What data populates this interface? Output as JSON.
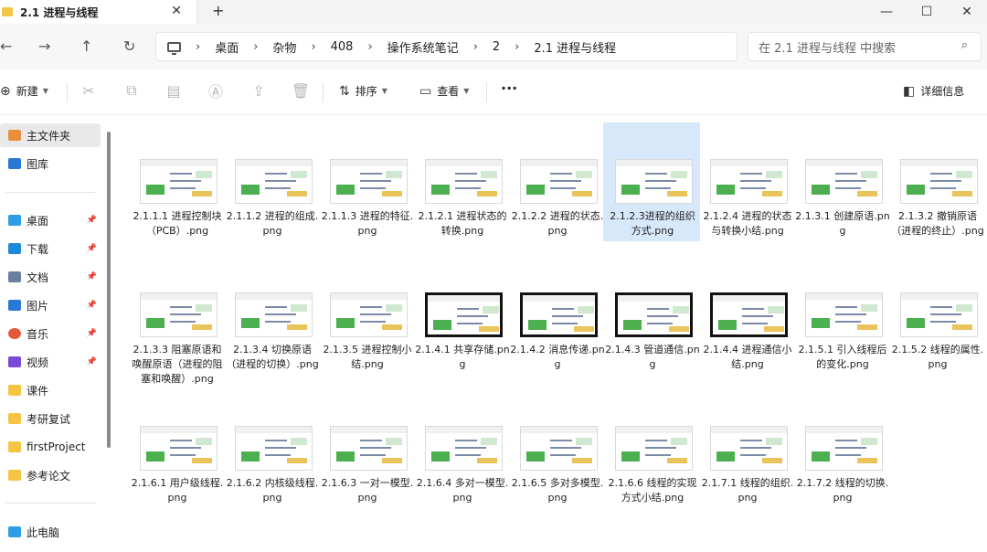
{
  "window": {
    "tab_title": "2.1 进程与线程",
    "tab_close": "✕",
    "new_tab": "+",
    "minimize": "—",
    "maximize": "☐",
    "close": "✕"
  },
  "nav": {
    "back": "←",
    "forward": "→",
    "up": "↑",
    "refresh": "↻"
  },
  "breadcrumb": [
    "桌面",
    "杂物",
    "408",
    "操作系统笔记",
    "2",
    "2.1 进程与线程"
  ],
  "search": {
    "placeholder": "在 2.1 进程与线程 中搜索"
  },
  "commands": {
    "new_label": "新建",
    "sort_label": "排序",
    "view_label": "查看",
    "more": "···",
    "details_label": "详细信息"
  },
  "sidebar": {
    "items": [
      {
        "label": "主文件夹",
        "icon": "home-icon",
        "pinned": false,
        "selected": true,
        "color": "#e88f3d"
      },
      {
        "label": "图库",
        "icon": "gallery-icon",
        "pinned": false,
        "selected": false,
        "color": "#2b77d6"
      },
      {
        "label": "桌面",
        "icon": "desktop-icon",
        "pinned": true,
        "selected": false,
        "color": "#2e9de6"
      },
      {
        "label": "下载",
        "icon": "download-icon",
        "pinned": true,
        "selected": false,
        "color": "#1c8ad8"
      },
      {
        "label": "文档",
        "icon": "documents-icon",
        "pinned": true,
        "selected": false,
        "color": "#6b7fa0"
      },
      {
        "label": "图片",
        "icon": "pictures-icon",
        "pinned": true,
        "selected": false,
        "color": "#2b77d6"
      },
      {
        "label": "音乐",
        "icon": "music-icon",
        "pinned": true,
        "selected": false,
        "color": "#e05a3b"
      },
      {
        "label": "视频",
        "icon": "videos-icon",
        "pinned": true,
        "selected": false,
        "color": "#7a4bd6"
      },
      {
        "label": "课件",
        "icon": "folder-icon",
        "pinned": false,
        "selected": false,
        "color": "#f4c542"
      },
      {
        "label": "考研复试",
        "icon": "folder-icon",
        "pinned": false,
        "selected": false,
        "color": "#f4c542"
      },
      {
        "label": "firstProject",
        "icon": "folder-icon",
        "pinned": false,
        "selected": false,
        "color": "#f4c542"
      },
      {
        "label": "参考论文",
        "icon": "folder-icon",
        "pinned": false,
        "selected": false,
        "color": "#f4c542"
      },
      {
        "label": "此电脑",
        "icon": "this-pc-icon",
        "pinned": false,
        "selected": false,
        "color": "#2e9de6"
      }
    ]
  },
  "files": [
    {
      "name": "2.1.1.1 进程控制块（PCB）.png",
      "dark": false,
      "selected": false
    },
    {
      "name": "2.1.1.2 进程的组成.png",
      "dark": false,
      "selected": false
    },
    {
      "name": "2.1.1.3 进程的特征.png",
      "dark": false,
      "selected": false
    },
    {
      "name": "2.1.2.1 进程状态的转换.png",
      "dark": false,
      "selected": false
    },
    {
      "name": "2.1.2.2 进程的状态.png",
      "dark": false,
      "selected": false
    },
    {
      "name": "2.1.2.3进程的组织方式.png",
      "dark": false,
      "selected": true
    },
    {
      "name": "2.1.2.4 进程的状态与转换小结.png",
      "dark": false,
      "selected": false
    },
    {
      "name": "2.1.3.1 创建原语.png",
      "dark": false,
      "selected": false
    },
    {
      "name": "2.1.3.2 撤销原语（进程的终止）.png",
      "dark": false,
      "selected": false
    },
    {
      "name": "2.1.3.3 阻塞原语和唤醒原语（进程的阻塞和唤醒）.png",
      "dark": false,
      "selected": false
    },
    {
      "name": "2.1.3.4 切换原语（进程的切换）.png",
      "dark": false,
      "selected": false
    },
    {
      "name": "2.1.3.5 进程控制小结.png",
      "dark": false,
      "selected": false
    },
    {
      "name": "2.1.4.1 共享存储.png",
      "dark": true,
      "selected": false
    },
    {
      "name": "2.1.4.2 消息传递.png",
      "dark": true,
      "selected": false
    },
    {
      "name": "2.1.4.3 管道通信.png",
      "dark": true,
      "selected": false
    },
    {
      "name": "2.1.4.4 进程通信小结.png",
      "dark": true,
      "selected": false
    },
    {
      "name": "2.1.5.1 引入线程后的变化.png",
      "dark": false,
      "selected": false
    },
    {
      "name": "2.1.5.2 线程的属性.png",
      "dark": false,
      "selected": false
    },
    {
      "name": "2.1.6.1 用户级线程.png",
      "dark": false,
      "selected": false
    },
    {
      "name": "2.1.6.2 内核级线程.png",
      "dark": false,
      "selected": false
    },
    {
      "name": "2.1.6.3 一对一模型.png",
      "dark": false,
      "selected": false
    },
    {
      "name": "2.1.6.4 多对一模型.png",
      "dark": false,
      "selected": false
    },
    {
      "name": "2.1.6.5 多对多模型.png",
      "dark": false,
      "selected": false
    },
    {
      "name": "2.1.6.6 线程的实现方式小结.png",
      "dark": false,
      "selected": false
    },
    {
      "name": "2.1.7.1 线程的组织.png",
      "dark": false,
      "selected": false
    },
    {
      "name": "2.1.7.2 线程的切换.png",
      "dark": false,
      "selected": false
    }
  ]
}
